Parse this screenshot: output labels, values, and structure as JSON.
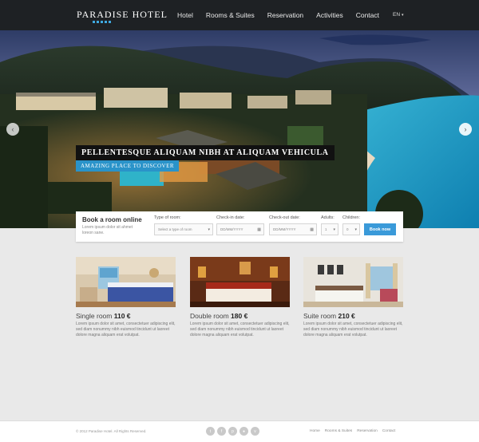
{
  "header": {
    "logo": "PARADISE HOTEL",
    "nav": [
      "Hotel",
      "Rooms & Suites",
      "Reservation",
      "Activities",
      "Contact"
    ],
    "lang": "EN"
  },
  "hero": {
    "caption_title": "PELLENTESQUE ALIQUAM NIBH AT ALIQUAM VEHICULA",
    "caption_subtitle": "AMAZING PLACE TO DISCOVER"
  },
  "booking": {
    "title": "Book a room online",
    "desc": "Lorem ipsum dolor sit ahmet loreon sane.",
    "room_type_label": "Type of room:",
    "room_type_value": "Select a type of room",
    "checkin_label": "Check-in date:",
    "checkin_placeholder": "DD/MM/YYYY",
    "checkout_label": "Check-out date:",
    "checkout_placeholder": "DD/MM/YYYY",
    "adults_label": "Adults:",
    "adults_value": "1",
    "children_label": "Children:",
    "children_value": "0",
    "button": "Book now"
  },
  "rooms": [
    {
      "name": "Single room",
      "price": "110 €",
      "desc": "Lorem ipsum dolor sit amet, consectetuer adipiscing elit, sed diam nonummy nibh euismod tincidunt ut laoreet dolore magna aliquam erat volutpat."
    },
    {
      "name": "Double room",
      "price": "180 €",
      "desc": "Lorem ipsum dolor sit amet, consectetuer adipiscing elit, sed diam nonummy nibh euismod tincidunt ut laoreet dolore magna aliquam erat volutpat."
    },
    {
      "name": "Suite room",
      "price": "210 €",
      "desc": "Lorem ipsum dolor sit amet, consectetuer adipiscing elit, sed diam nonummy nibh euismod tincidunt ut laoreet dolore magna aliquam erat volutpat."
    }
  ],
  "footer": {
    "copyright": "© 2012 Paradise Hotel. All Rights Reserved.",
    "social": [
      "twitter",
      "facebook",
      "pinterest",
      "flickr",
      "vimeo"
    ],
    "nav": [
      "Home",
      "Rooms & Suites",
      "Reservation",
      "Contact"
    ]
  },
  "colors": {
    "accent": "#3a9ad9",
    "header": "#1e2124"
  }
}
